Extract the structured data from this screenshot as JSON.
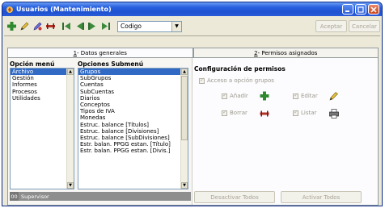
{
  "window": {
    "title": "Usuarios (Mantenimiento)"
  },
  "toolbar": {
    "select_value": "Codigo",
    "accept_label": "Aceptar",
    "cancel_label": "Cancelar",
    "icons": [
      "add-icon",
      "edit-icon",
      "edit-alt-icon",
      "delete-icon",
      "first-record-icon",
      "previous-record-icon",
      "next-record-icon",
      "last-record-icon"
    ]
  },
  "tabs": [
    {
      "number": "1",
      "label": " - Datos generales"
    },
    {
      "number": "2",
      "label": " - Permisos asignados"
    }
  ],
  "left": {
    "menu_heading": "Opción menú",
    "submenu_heading": "Opciones Submenú",
    "menu_items": [
      "Archivo",
      "Gestión",
      "Informes",
      "Procesos",
      "Utilidades"
    ],
    "submenu_items": [
      "Grupos",
      "SubGrupos",
      "Cuentas",
      "SubCuentas",
      "Diarios",
      "Conceptos",
      "Tipos de IVA",
      "Monedas",
      "Estruc. balance [Títulos]",
      "Estruc. balance [Divisiones]",
      "Estruc. balance [SubDivisiones]",
      "Estr. balan. PPGG estan. [Título]",
      "Estr. balan. PPGG estan. [Divis.]"
    ],
    "status_code": "00",
    "status_text": "Supervisor"
  },
  "right": {
    "heading": "Configuración de permisos",
    "access_label": "Acceso a opción grupos",
    "add_label": "Añadir",
    "edit_label": "Editar",
    "delete_label": "Borrar",
    "list_label": "Listar",
    "deactivate_all": "Desactivar Todos",
    "activate_all": "Activar Todos"
  }
}
